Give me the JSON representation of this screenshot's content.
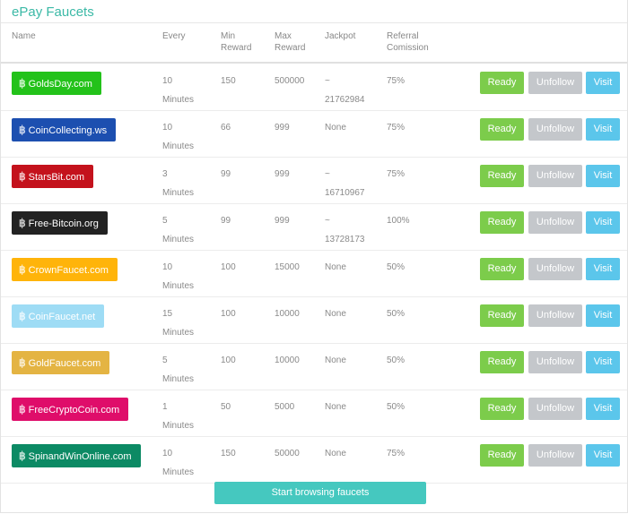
{
  "panel": {
    "title": "ePay Faucets"
  },
  "headers": {
    "name": "Name",
    "every": "Every",
    "min": [
      "Min",
      "Reward"
    ],
    "max": [
      "Max",
      "Reward"
    ],
    "jackpot": "Jackpot",
    "referral": [
      "Referral",
      "Comission"
    ]
  },
  "buttons": {
    "ready": "Ready",
    "unfollow": "Unfollow",
    "visit": "Visit"
  },
  "start_label": "Start browsing faucets",
  "rows": [
    {
      "site": "GoldsDay.com",
      "color": "#23c21a",
      "every": [
        "10",
        "Minutes"
      ],
      "min": "150",
      "max": "500000",
      "jackpot": [
        "~",
        "21762984"
      ],
      "referral": "75%"
    },
    {
      "site": "CoinCollecting.ws",
      "color": "#1c4fb0",
      "every": [
        "10",
        "Minutes"
      ],
      "min": "66",
      "max": "999",
      "jackpot": [
        "None",
        ""
      ],
      "referral": "75%"
    },
    {
      "site": "StarsBit.com",
      "color": "#c4121c",
      "every": [
        "3",
        "Minutes"
      ],
      "min": "99",
      "max": "999",
      "jackpot": [
        "~",
        "16710967"
      ],
      "referral": "75%"
    },
    {
      "site": "Free-Bitcoin.org",
      "color": "#222222",
      "every": [
        "5",
        "Minutes"
      ],
      "min": "99",
      "max": "999",
      "jackpot": [
        "~",
        "13728173"
      ],
      "referral": "100%"
    },
    {
      "site": "CrownFaucet.com",
      "color": "#ffb40a",
      "every": [
        "10",
        "Minutes"
      ],
      "min": "100",
      "max": "15000",
      "jackpot": [
        "None",
        ""
      ],
      "referral": "50%"
    },
    {
      "site": "CoinFaucet.net",
      "color": "#9edcf5",
      "every": [
        "15",
        "Minutes"
      ],
      "min": "100",
      "max": "10000",
      "jackpot": [
        "None",
        ""
      ],
      "referral": "50%"
    },
    {
      "site": "GoldFaucet.com",
      "color": "#e4b443",
      "every": [
        "5",
        "Minutes"
      ],
      "min": "100",
      "max": "10000",
      "jackpot": [
        "None",
        ""
      ],
      "referral": "50%"
    },
    {
      "site": "FreeCryptoCoin.com",
      "color": "#df0d6a",
      "every": [
        "1",
        "Minutes"
      ],
      "min": "50",
      "max": "5000",
      "jackpot": [
        "None",
        ""
      ],
      "referral": "50%"
    },
    {
      "site": "SpinandWinOnline.com",
      "color": "#0c8a64",
      "every": [
        "10",
        "Minutes"
      ],
      "min": "150",
      "max": "50000",
      "jackpot": [
        "None",
        ""
      ],
      "referral": "75%"
    }
  ]
}
